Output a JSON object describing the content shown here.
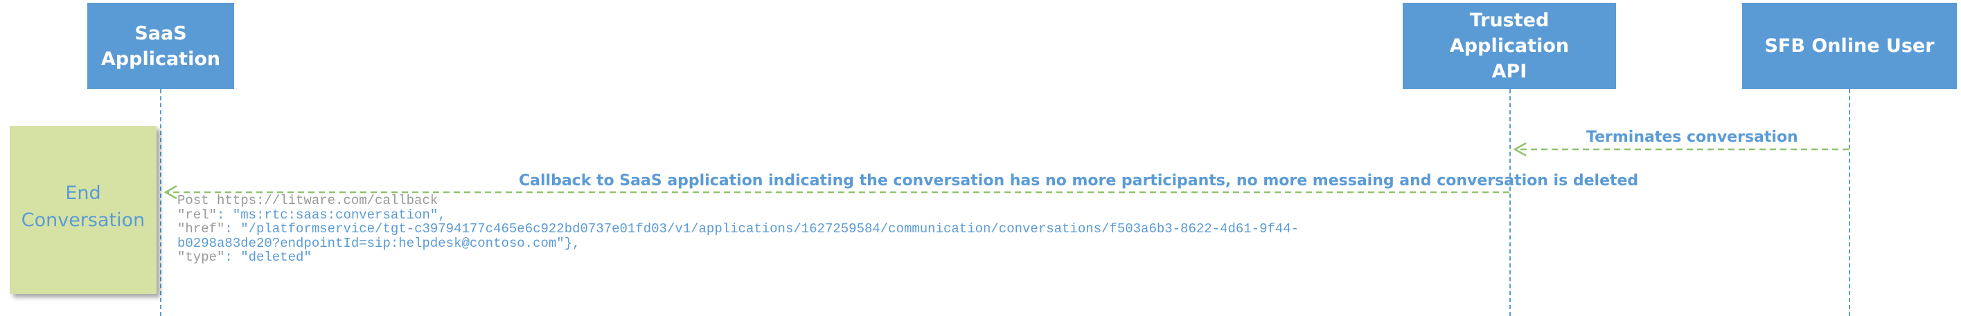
{
  "actors": [
    {
      "id": "saas",
      "lines": [
        "SaaS",
        "Application"
      ]
    },
    {
      "id": "trusted",
      "lines": [
        "Trusted Application",
        "API"
      ]
    },
    {
      "id": "sfb",
      "lines": [
        "SFB Online User"
      ]
    }
  ],
  "activity": {
    "lines": [
      "End",
      "Conversation"
    ]
  },
  "messages": {
    "terminates": "Terminates conversation",
    "callback": "Callback to SaaS application indicating the conversation has no more participants, no more messaing and conversation is deleted"
  },
  "payload": {
    "post_line": "Post https://litware.com/callback",
    "rel_key": "\"rel\"",
    "rel_rest": ": \"ms:rtc:saas:conversation\",",
    "href_key": "\"href\"",
    "href_rest": ": \"/platformservice/tgt-c39794177c465e6c922bd0737e01fd03/v1/applications/1627259584/communication/conversations/f503a6b3-8622-4d61-9f44-",
    "href_cont": "b0298a83de20?endpointId=sip:helpdesk@contoso.com\"},",
    "type_key": "\"type\"",
    "type_rest": ": \"deleted\""
  },
  "colors": {
    "actor_fill": "#5b9bd5",
    "actor_text": "#ffffff",
    "activity_fill": "#d6e2a4",
    "message_arrow": "#8fc46a",
    "lifeline": "#5b9bd5"
  }
}
